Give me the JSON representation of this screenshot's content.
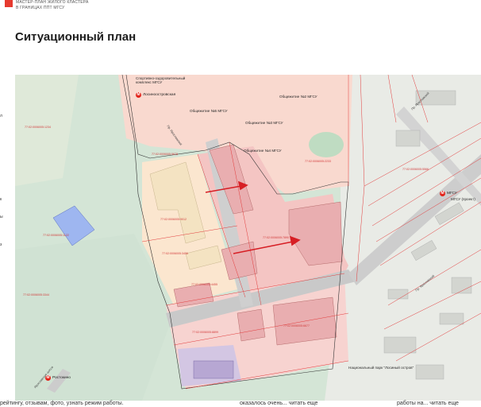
{
  "header": {
    "line1": "МАСТЕР-ПЛАН ЖИЛОГО КЛАСТЕРА",
    "line2": "В ГРАНИЦАХ ППТ МГСУ"
  },
  "page_title": "Ситуационный план",
  "map": {
    "labels": {
      "sport": "Спортивно-оздоровительный комплекс МГСУ",
      "dorm5": "Общежитие №5 МГСУ",
      "dorm2": "Общежитие №2 МГСУ",
      "dorm3": "Общежитие №3 МГСУ",
      "dorm4": "Общежитие №4 МГСУ",
      "park": "Национальный парк \"Лосиный остров\"",
      "mgsu_project": "МГСУ (проект)"
    },
    "metro": {
      "losinoostrovskaya": "Лосиноостровская",
      "rostokino": "Ростокино",
      "mgsu": "МГСУ"
    },
    "streets": {
      "street_a": "Пр. Ярославский",
      "street_b": "Пр. Ярославский",
      "street_c": "Пр. Ярославский",
      "street_d": "Ярославское шоссе"
    },
    "cadastral": [
      "77:02:0006005:1234",
      "77:02:0006005:5678",
      "77:02:0006005:9012",
      "77:02:0006005:3456",
      "77:02:0006005:7890",
      "77:02:0006005:2233",
      "77:02:0006005:4455",
      "77:02:0006005:6677",
      "77:02:0006005:8899",
      "77:02:0006005:1122",
      "77:02:0006005:3344",
      "77:02:0006005:5566"
    ],
    "colors": {
      "green_area": "#d4e5d6",
      "pink_parcel": "#f7d3d0",
      "dark_pink": "#f2b7b6",
      "peach": "#fbe6cf",
      "red_line": "#e23b3b",
      "arrow": "#d71f25",
      "road": "#c9c9c9",
      "blue": "#9eb6f0"
    }
  },
  "left_edge": [
    "л",
    "к",
    "ы",
    "з"
  ],
  "bottom_strip": {
    "left": "рейтингу, отзывам, фото, узнать режим работы.",
    "middle": "оказалось очень... читать еще",
    "right": "работы на... читать еще"
  }
}
